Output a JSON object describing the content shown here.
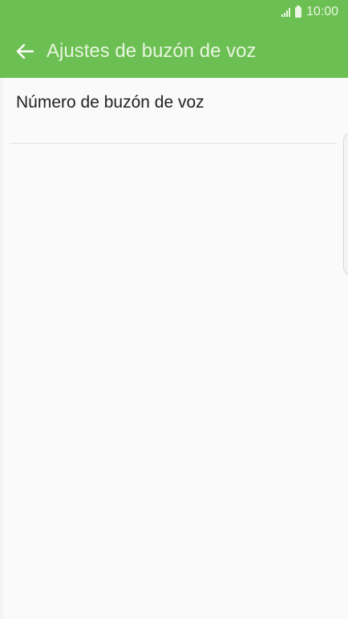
{
  "status_bar": {
    "time": "10:00",
    "icons": [
      "signal-icon",
      "battery-icon"
    ]
  },
  "app_bar": {
    "back_icon": "arrow-left-icon",
    "title": "Ajustes de buzón de voz"
  },
  "settings": {
    "items": [
      {
        "label": "Número de buzón de voz"
      }
    ]
  },
  "colors": {
    "primary": "#6cbf52",
    "title_text": "#e7f5df",
    "background": "#fafafa",
    "item_text": "#222222",
    "divider": "#e4e4e4"
  }
}
